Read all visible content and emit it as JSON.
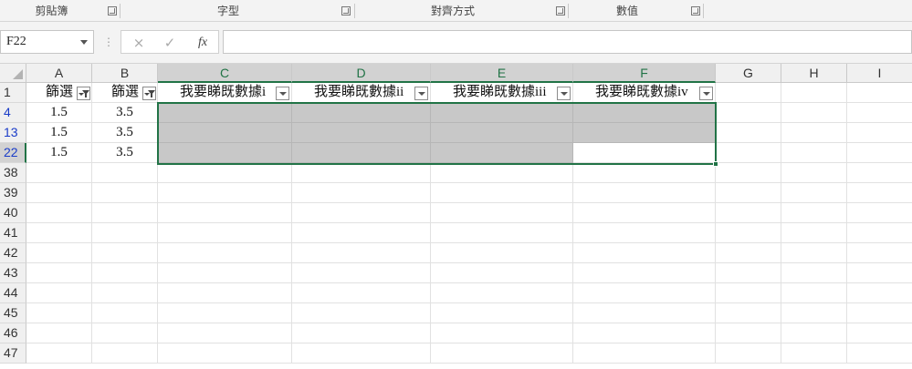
{
  "ribbon": {
    "groups": [
      {
        "label": "剪貼簿"
      },
      {
        "label": "字型"
      },
      {
        "label": "對齊方式"
      },
      {
        "label": "數值"
      }
    ]
  },
  "formula_bar": {
    "name_box": "F22",
    "cancel_icon": "×",
    "enter_icon": "✓",
    "fx_label": "fx",
    "formula": ""
  },
  "sheet": {
    "columns": [
      "A",
      "B",
      "C",
      "D",
      "E",
      "F",
      "G",
      "H",
      "I"
    ],
    "selected_columns": [
      "C",
      "D",
      "E",
      "F"
    ],
    "header_row": {
      "row_label": "1",
      "cells": [
        "篩選",
        "篩選",
        "我要睇既數據i",
        "我要睇既數據ii",
        "我要睇既數據iii",
        "我要睇既數據iv"
      ]
    },
    "data_rows": [
      {
        "row_label": "4",
        "cells": [
          "1.5",
          "3.5",
          "",
          "",
          "",
          ""
        ]
      },
      {
        "row_label": "13",
        "cells": [
          "1.5",
          "3.5",
          "",
          "",
          "",
          ""
        ]
      },
      {
        "row_label": "22",
        "cells": [
          "1.5",
          "3.5",
          "",
          "",
          "",
          ""
        ]
      }
    ],
    "empty_rows": [
      "38",
      "39",
      "40",
      "41",
      "42",
      "43",
      "44",
      "45",
      "46",
      "47"
    ],
    "active_cell": "F22",
    "selection_range": "C4:F22"
  },
  "colors": {
    "accent": "#217346",
    "selection_fill": "#c8c8c8",
    "filtered_row_number": "#1a3cc8"
  }
}
